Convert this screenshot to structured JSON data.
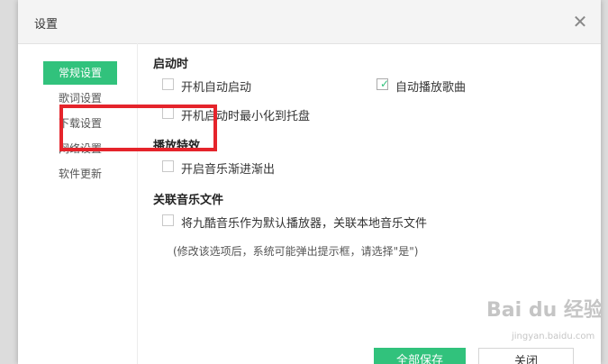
{
  "window": {
    "title": "设置",
    "close_icon": "close-icon"
  },
  "sidebar": {
    "items": [
      {
        "label": "常规设置",
        "active": true
      },
      {
        "label": "歌词设置",
        "active": false
      },
      {
        "label": "下载设置",
        "active": false
      },
      {
        "label": "网络设置",
        "active": false
      },
      {
        "label": "软件更新",
        "active": false
      }
    ]
  },
  "sections": {
    "startup": {
      "title": "启动时",
      "options": [
        {
          "label": "开机自动启动",
          "checked": false
        },
        {
          "label": "自动播放歌曲",
          "checked": true
        },
        {
          "label": "开机启动时最小化到托盘",
          "checked": false
        }
      ]
    },
    "effects": {
      "title": "播放特效",
      "options": [
        {
          "label": "开启音乐渐进渐出",
          "checked": false
        }
      ]
    },
    "association": {
      "title": "关联音乐文件",
      "options": [
        {
          "label": "将九酷音乐作为默认播放器，关联本地音乐文件",
          "checked": false
        }
      ],
      "note": "(修改该选项后，系统可能弹出提示框，请选择\"是\")"
    }
  },
  "buttons": {
    "primary": "全部保存",
    "secondary": "关闭"
  },
  "watermark": {
    "text": "Bai du 经验",
    "sub": "jingyan.baidu.com"
  },
  "colors": {
    "accent": "#31c27c",
    "highlight_box": "#e5242b"
  }
}
